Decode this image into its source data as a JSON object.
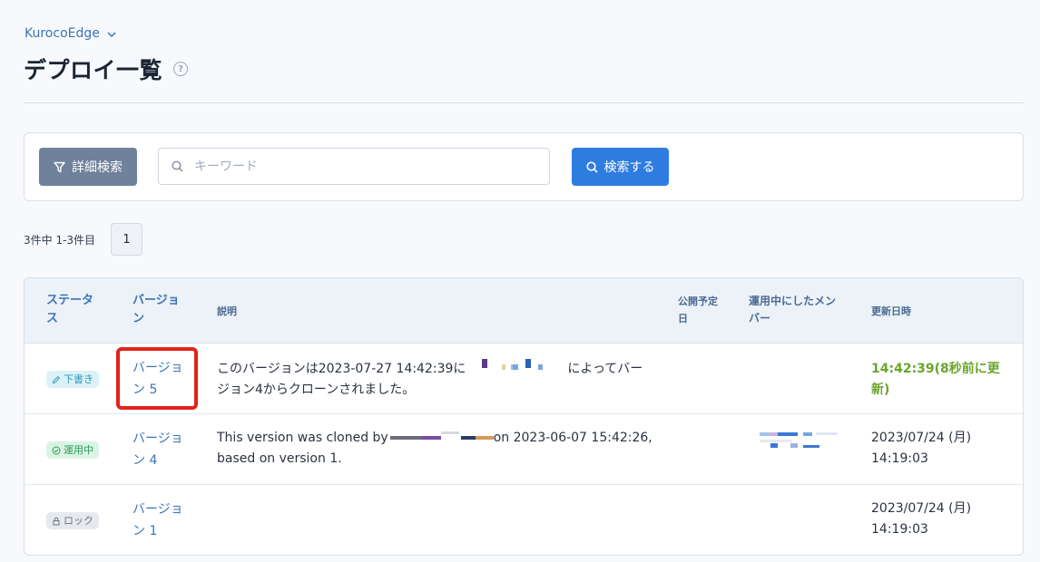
{
  "header": {
    "site_name": "KurocoEdge",
    "title": "デプロイ一覧"
  },
  "search": {
    "filter_label": "詳細検索",
    "keyword_placeholder": "キーワード",
    "search_label": "検索する"
  },
  "pagination": {
    "result_count": "3件中 1-3件目",
    "current_page": "1"
  },
  "table": {
    "headers": {
      "status": "ステータス",
      "version": "バージョン",
      "description": "説明",
      "publish_date": "公開予定日",
      "operator": "運用中にしたメンバー",
      "updated": "更新日時"
    },
    "rows": [
      {
        "status": "下書き",
        "version": "バージョン 5",
        "description_prefix": "このバージョンは2023-07-27 14:42:39に",
        "description_suffix": "によってバージョン4からクローンされました。",
        "updated": "14:42:39(8秒前に更新)"
      },
      {
        "status": "運用中",
        "version": "バージョン 4",
        "description_prefix": "This version was cloned by",
        "description_suffix": "on 2023-06-07 15:42:26, based on version 1.",
        "updated": "2023/07/24 (月) 14:19:03"
      },
      {
        "status": "ロック",
        "version": "バージョン 1",
        "description_prefix": "",
        "description_suffix": "",
        "updated": "2023/07/24 (月) 14:19:03"
      }
    ]
  },
  "colors": {
    "primary": "#2f7ce0",
    "filter_button": "#6f819b",
    "link": "#3b73b9",
    "highlight": "#e2231a",
    "fresh_update": "#6aa52b"
  },
  "icons": {
    "filter": "funnel-icon",
    "search": "magnifier-icon",
    "help": "question-circle-icon",
    "chevron": "chevron-down-icon",
    "draft": "pencil-icon",
    "active": "check-circle-icon",
    "locked": "lock-icon"
  }
}
